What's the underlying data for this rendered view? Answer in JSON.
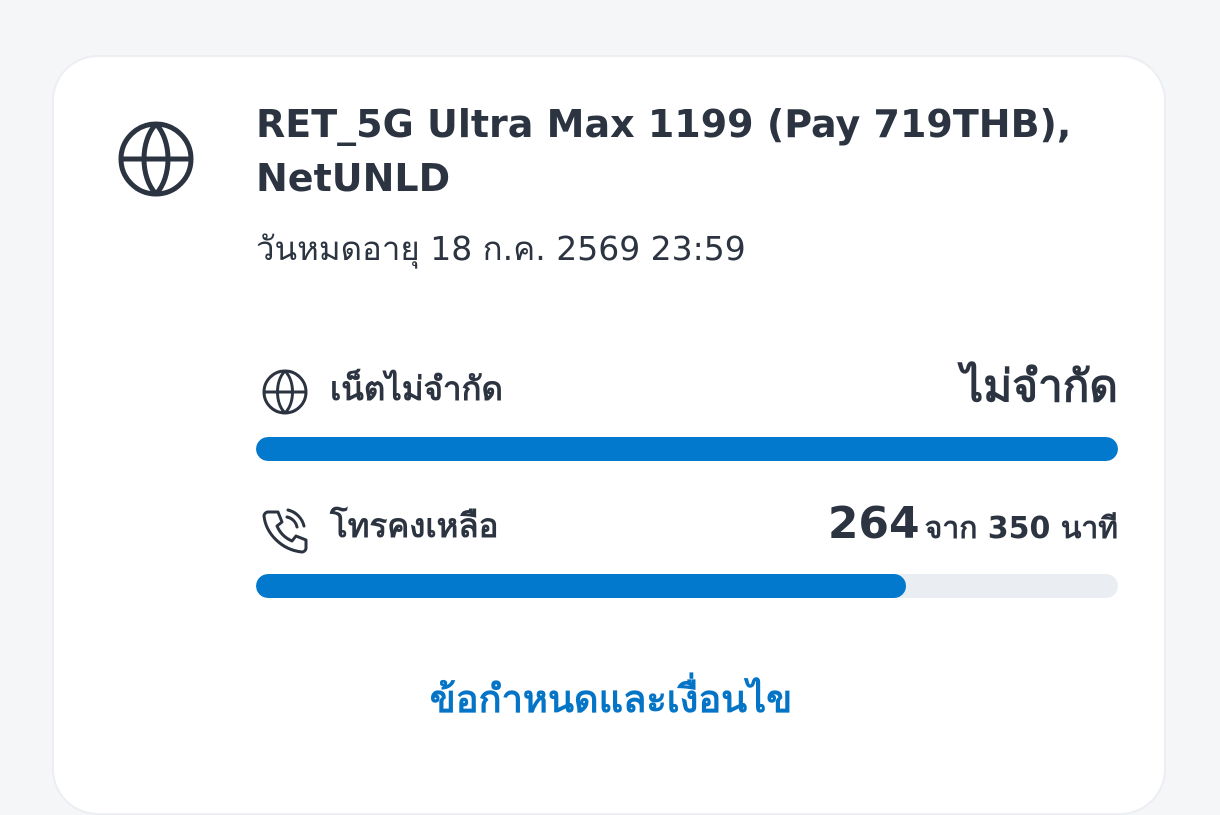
{
  "package": {
    "icon": "globe-icon",
    "title": "RET_5G Ultra Max 1199 (Pay 719THB), NetUNLD",
    "expiry": "วันหมดอายุ 18 ก.ค. 2569 23:59"
  },
  "data_usage": {
    "icon": "globe-icon",
    "label": "เน็ตไม่จำกัด",
    "value": "ไม่จำกัด",
    "fill_fraction": 1.0
  },
  "voice_usage": {
    "icon": "phone-call-icon",
    "label": "โทรคงเหลือ",
    "remaining": "264",
    "total_text": "จาก 350 นาที",
    "fill_fraction": 0.754
  },
  "terms_link": "ข้อกำหนดและเงื่อนไข",
  "colors": {
    "accent": "#0379cd",
    "link": "#0474c6",
    "text": "#2b3440",
    "track": "#eaedf2"
  }
}
